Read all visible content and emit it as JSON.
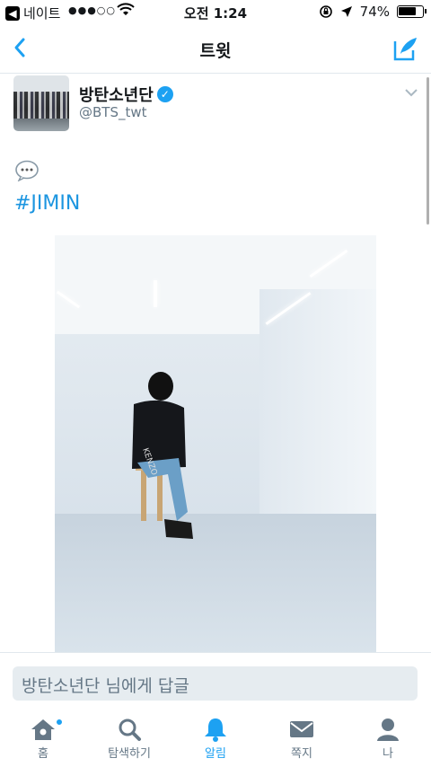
{
  "status_bar": {
    "carrier": "네이트",
    "signal": "●●●○○",
    "time": "오전 1:24",
    "battery": "74%",
    "battery_level": 0.74
  },
  "nav": {
    "title": "트윗"
  },
  "tweet": {
    "display_name": "방탄소년단",
    "handle": "@BTS_twt",
    "text_emoji": "💬",
    "hashtag": "#JIMIN"
  },
  "reply": {
    "placeholder": "방탄소년단 님에게 답글"
  },
  "tabs": [
    {
      "label": "홈",
      "icon": "home-icon"
    },
    {
      "label": "탐색하기",
      "icon": "search-icon"
    },
    {
      "label": "알림",
      "icon": "bell-icon"
    },
    {
      "label": "쪽지",
      "icon": "envelope-icon"
    },
    {
      "label": "나",
      "icon": "person-icon"
    }
  ],
  "colors": {
    "accent": "#1da1f2",
    "hashtag": "#1b95e0",
    "muted": "#657786"
  }
}
